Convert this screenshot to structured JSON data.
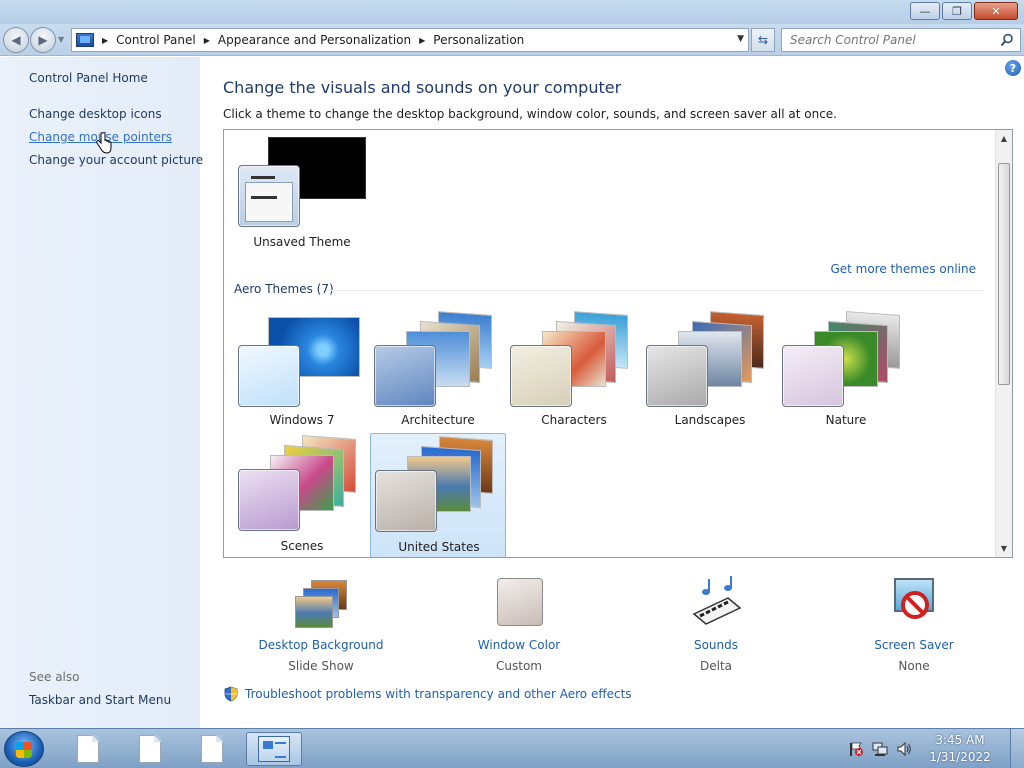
{
  "window": {
    "min_glyph": "—",
    "max_glyph": "❐",
    "close_glyph": "✕"
  },
  "nav": {
    "back_glyph": "◀",
    "forward_glyph": "▶",
    "breadcrumbs": [
      "Control Panel",
      "Appearance and Personalization",
      "Personalization"
    ],
    "search_placeholder": "Search Control Panel"
  },
  "sidebar": {
    "links": [
      "Control Panel Home",
      "Change desktop icons",
      "Change mouse pointers",
      "Change your account picture"
    ],
    "see_also_label": "See also",
    "see_also_links": [
      "Taskbar and Start Menu"
    ]
  },
  "main": {
    "title": "Change the visuals and sounds on your computer",
    "subtitle": "Click a theme to change the desktop background, window color, sounds, and screen saver all at once.",
    "unsaved_theme": "Unsaved Theme",
    "get_more_link": "Get more themes online",
    "aero_group_label": "Aero Themes (7)",
    "aero_themes": [
      "Windows 7",
      "Architecture",
      "Characters",
      "Landscapes",
      "Nature",
      "Scenes",
      "United States"
    ],
    "selected_theme": "United States"
  },
  "settings": [
    {
      "name": "Desktop Background",
      "value": "Slide Show"
    },
    {
      "name": "Window Color",
      "value": "Custom"
    },
    {
      "name": "Sounds",
      "value": "Delta"
    },
    {
      "name": "Screen Saver",
      "value": "None"
    }
  ],
  "troubleshoot_link": "Troubleshoot problems with transparency and other Aero effects",
  "taskbar": {
    "time": "3:45 AM",
    "date": "1/31/2022"
  }
}
